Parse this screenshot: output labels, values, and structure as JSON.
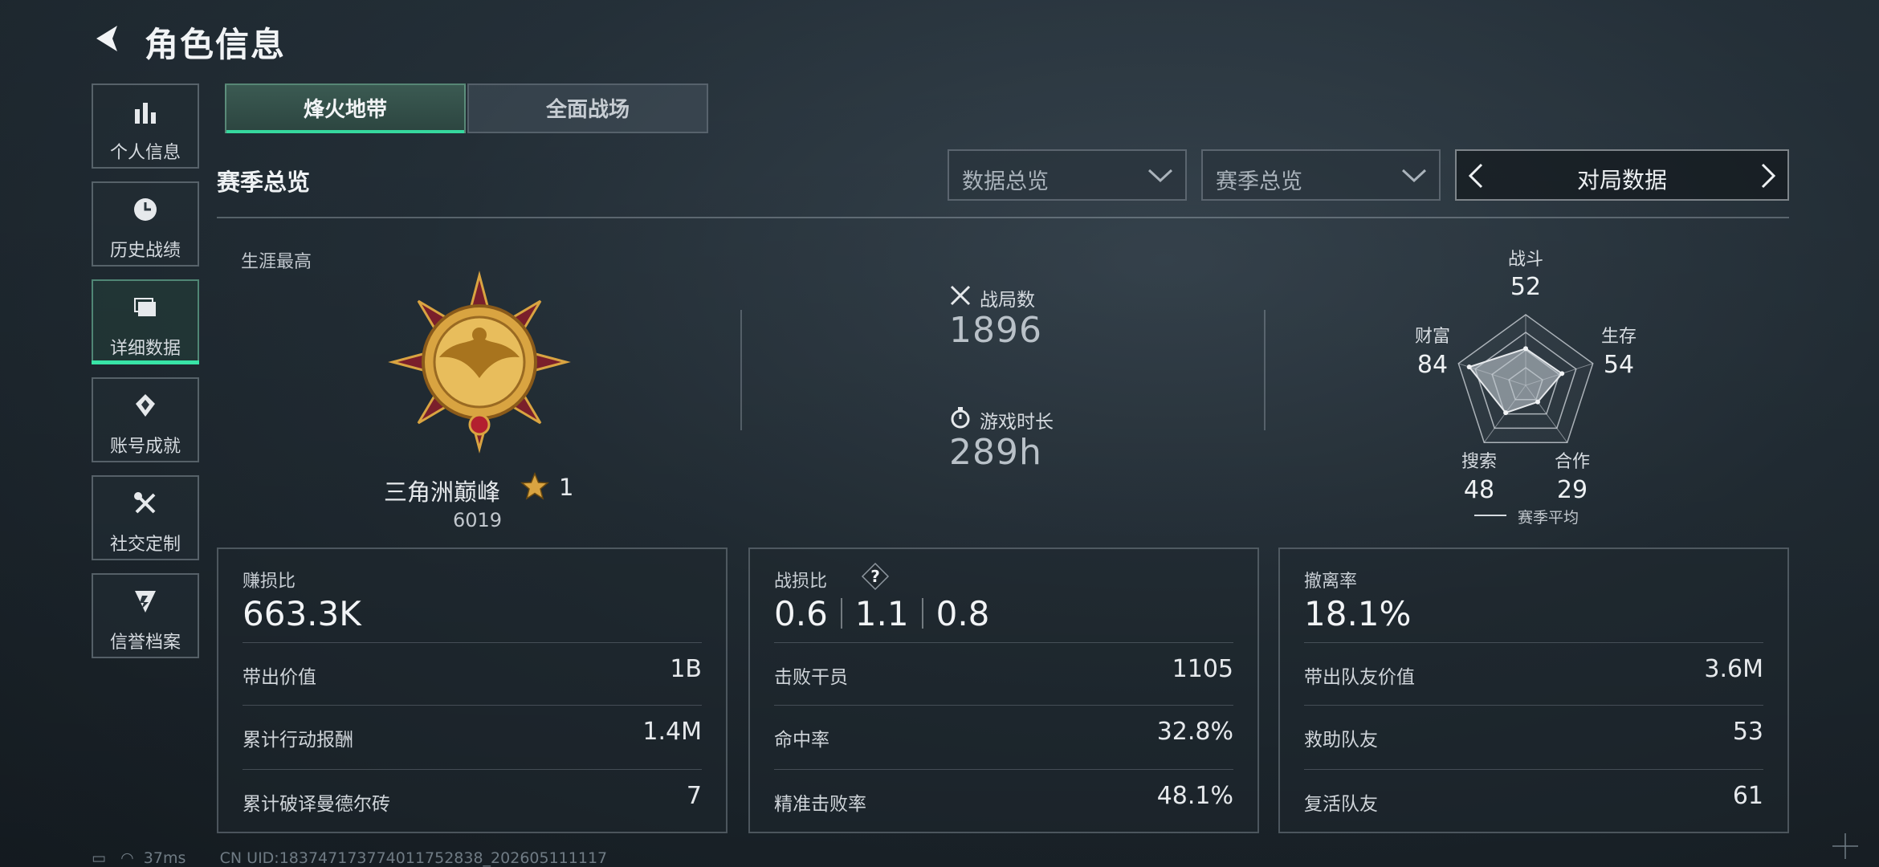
{
  "header": {
    "title": "角色信息"
  },
  "sidebar": {
    "items": [
      {
        "label": "个人信息",
        "icon": "bar-chart-icon"
      },
      {
        "label": "历史战绩",
        "icon": "clock-icon"
      },
      {
        "label": "详细数据",
        "icon": "folder-icon",
        "active": true
      },
      {
        "label": "账号成就",
        "icon": "achievement-icon"
      },
      {
        "label": "社交定制",
        "icon": "tools-icon"
      },
      {
        "label": "信誉档案",
        "icon": "shield-icon"
      }
    ]
  },
  "mode_tabs": [
    {
      "label": "烽火地带",
      "active": true
    },
    {
      "label": "全面战场",
      "active": false
    }
  ],
  "section": {
    "title": "赛季总览"
  },
  "filters": {
    "data_select": "数据总览",
    "season_select": "赛季总览",
    "view_switcher": "对局数据"
  },
  "overview": {
    "career_label": "生涯最高",
    "rank_name": "三角洲巅峰",
    "rank_star_level": "1",
    "rank_score": "6019",
    "matches_label": "战局数",
    "matches_value": "1896",
    "playtime_label": "游戏时长",
    "playtime_value": "289h"
  },
  "radar": {
    "axes": [
      {
        "label": "战斗",
        "value": 52
      },
      {
        "label": "生存",
        "value": 54
      },
      {
        "label": "合作",
        "value": 29
      },
      {
        "label": "搜索",
        "value": 48
      },
      {
        "label": "财富",
        "value": 84
      }
    ],
    "legend": "赛季平均"
  },
  "cards": {
    "profit": {
      "title": "赚损比",
      "value": "663.3K",
      "rows": [
        {
          "label": "带出价值",
          "value": "1B"
        },
        {
          "label": "累计行动报酬",
          "value": "1.4M"
        },
        {
          "label": "累计破译曼德尔砖",
          "value": "7"
        }
      ]
    },
    "kd": {
      "title": "战损比",
      "help": "?",
      "values": [
        "0.6",
        "1.1",
        "0.8"
      ],
      "rows": [
        {
          "label": "击败干员",
          "value": "1105"
        },
        {
          "label": "命中率",
          "value": "32.8%"
        },
        {
          "label": "精准击败率",
          "value": "48.1%"
        }
      ]
    },
    "extract": {
      "title": "撤离率",
      "value": "18.1%",
      "rows": [
        {
          "label": "带出队友价值",
          "value": "3.6M"
        },
        {
          "label": "救助队友",
          "value": "53"
        },
        {
          "label": "复活队友",
          "value": "61"
        }
      ]
    }
  },
  "status_bar": {
    "ping": "37ms",
    "uid": "CN UID:18374717377401175283​8_202605111117"
  },
  "colors": {
    "accent": "#36d89e",
    "medal_gold": "#d9a441",
    "medal_red": "#7a1f2b"
  }
}
